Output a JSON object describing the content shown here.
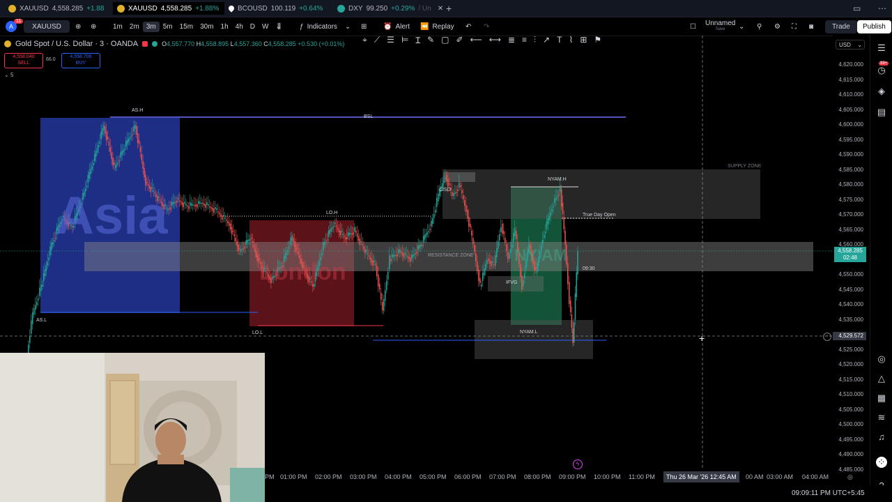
{
  "tabs": [
    {
      "symbol": "XAUUSD",
      "price": "4,558.285",
      "change": "+1.88",
      "active": false
    },
    {
      "symbol": "XAUUSD",
      "price": "4,558.285",
      "change": "+1.88%",
      "active": true
    },
    {
      "symbol": "BCOUSD",
      "price": "100.119",
      "change": "+0.64%",
      "active": false
    },
    {
      "symbol": "DXY",
      "price": "99.250",
      "change": "+0.29%",
      "extra": "/ Un",
      "active": false
    }
  ],
  "toolbar": {
    "symbol": "XAUUSD",
    "notification_badge": "11",
    "timeframes": [
      "1m",
      "2m",
      "3m",
      "5m",
      "15m",
      "30m",
      "1h",
      "4h",
      "D",
      "W"
    ],
    "selected_timeframe": "3m",
    "indicators": "Indicators",
    "alert": "Alert",
    "replay": "Replay",
    "layout_name": "Unnamed",
    "layout_status": "Save",
    "trade": "Trade",
    "publish": "Publish"
  },
  "legend": {
    "title": "Gold Spot / U.S. Dollar · 3 · OANDA",
    "open": "4,557.770",
    "high": "4,558.895",
    "low": "4,557.360",
    "close": "4,558.285",
    "change": "+0.530 (+0.01%)",
    "sell_price": "4,558.040",
    "sell_label": "SELL",
    "spread": "66.0",
    "buy_price": "4,558.706",
    "buy_label": "BUY",
    "indicator_count": "5"
  },
  "currency": "USD",
  "price_axis": [
    "4,620.000",
    "4,615.000",
    "4,610.000",
    "4,605.000",
    "4,600.000",
    "4,595.000",
    "4,590.000",
    "4,585.000",
    "4,580.000",
    "4,575.000",
    "4,570.000",
    "4,565.000",
    "4,560.000",
    "4,555.000",
    "4,550.000",
    "4,545.000",
    "4,540.000",
    "4,535.000",
    "4,530.000",
    "4,525.000",
    "4,520.000",
    "4,515.000",
    "4,510.000",
    "4,505.000",
    "4,500.000",
    "4,495.000",
    "4,490.000",
    "4,485.000"
  ],
  "current_price_label": "4,558.285",
  "countdown": "02:48",
  "crosshair_price": "4,529.572",
  "time_axis": [
    "PM",
    "01:00 PM",
    "02:00 PM",
    "03:00 PM",
    "04:00 PM",
    "05:00 PM",
    "06:00 PM",
    "07:00 PM",
    "08:00 PM",
    "09:00 PM",
    "10:00 PM",
    "11:00 PM",
    "00 AM",
    "03:00 AM",
    "04:00 AM"
  ],
  "crosshair_time": "Thu 26 Mar '26   12:45 AM",
  "clock": "09:09:11 PM UTC+5:45",
  "right_badge": "99+",
  "annotations": {
    "as_h": "AS.H",
    "as_l": "AS.L",
    "bsl": "BSL",
    "lo_h": "LO.H",
    "lo_l": "LO.L",
    "nyam_h": "NYAM.H",
    "nyam_l": "NYAM.L",
    "cisd": "CISD",
    "ifvg": "IFVG",
    "supply_zone": "SUPPLY ZONE",
    "resistance_zone": "RESISTANCE ZONE",
    "true_day_open": "True Day Open",
    "time_0930": "09:30",
    "asia": "Asia",
    "london": "London",
    "ny_am": "NY AM"
  },
  "colors": {
    "bull": "#26a69a",
    "bear": "#ef5350",
    "asia": "#2a3eb1",
    "london": "#7a1a22",
    "nyam": "#1f8a5b",
    "accent": "#2962ff"
  }
}
